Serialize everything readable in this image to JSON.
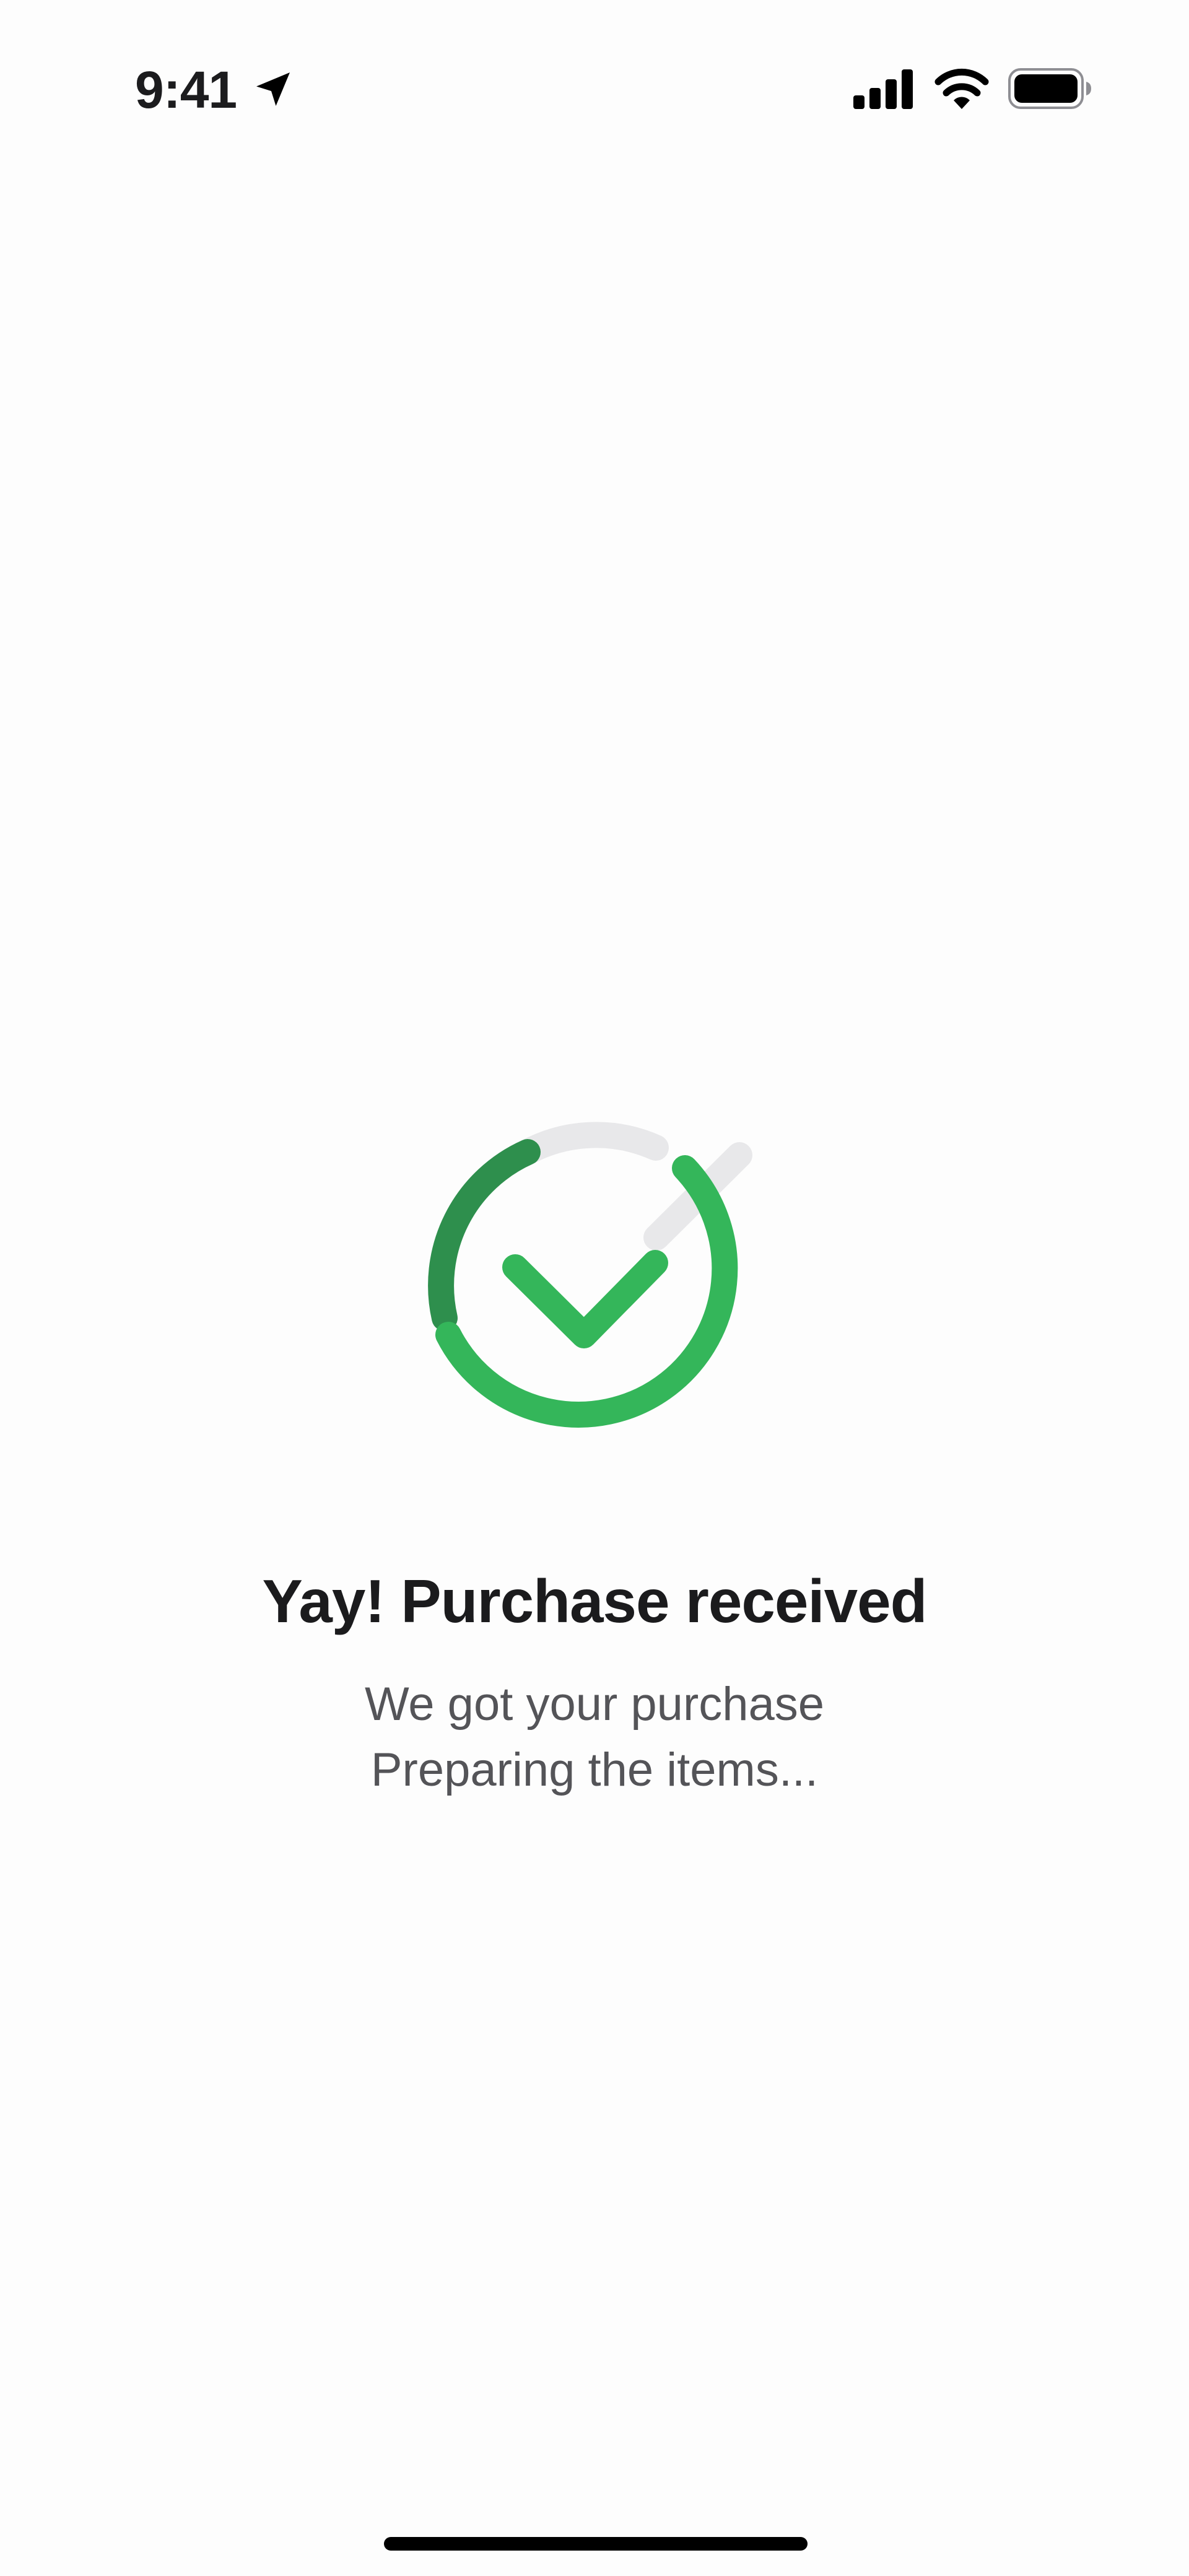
{
  "status_bar": {
    "time": "9:41",
    "icons": [
      "location-arrow-icon",
      "cellular-signal-icon",
      "wifi-icon",
      "battery-icon"
    ]
  },
  "success": {
    "icon": "checkmark-circle-icon",
    "title": "Yay! Purchase received",
    "line1": "We got your purchase",
    "line2": "Preparing the items..."
  },
  "colors": {
    "accent_green": "#34b65a",
    "dark_green": "#2e8f4d",
    "track_gray": "#e8e8ea",
    "text_primary": "#1b1b1d",
    "text_secondary": "#545458",
    "background": "#fdfdfd"
  }
}
